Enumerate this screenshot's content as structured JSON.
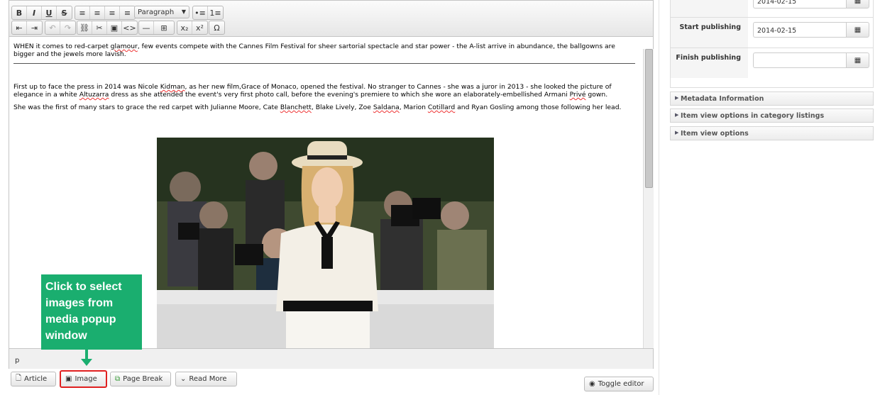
{
  "toolbar": {
    "row1": [
      "B",
      "I",
      "U",
      "S",
      "≡",
      "≡",
      "≡",
      "≡"
    ],
    "format_select": "Paragraph",
    "row2_extra": [
      "•≡",
      "1≡"
    ],
    "row3": [
      "⇤",
      "⇥",
      "↶",
      "↷",
      "⛓",
      "✂",
      "▣",
      "<>",
      "—",
      "⊞",
      "x₂",
      "x²",
      "Ω"
    ]
  },
  "content": {
    "p1a": "WHEN it comes to red-carpet ",
    "p1_glamour": "glamour",
    "p1b": ", few events compete with the Cannes Film Festival for sheer sartorial spectacle and star power - the A-list arrive in abundance, the ballgowns are bigger and the jewels more lavish.",
    "p2a": "First up to face the press in 2014 was Nicole ",
    "p2_kidman": "Kidman",
    "p2b": ", as her new film,Grace of Monaco, opened the festival. No stranger to Cannes - she was a juror in 2013 - she looked the picture of elegance in a white ",
    "p2_altuzarra": "Altuzarra",
    "p2c": " dress as she attended the event's very first photo call, before the evening's premiere to which she wore an elaborately-embellished Armani ",
    "p2_prive": "Privé",
    "p2d": " gown.",
    "p3a": "She was the first of many stars to grace the red carpet with Julianne Moore, Cate ",
    "p3_blanchett": "Blanchett",
    "p3b": ", Blake Lively, Zoe ",
    "p3_saldana": "Saldana",
    "p3c": ", Marion ",
    "p3_cotillard": "Cotillard",
    "p3d": " and Ryan Gosling among those following her lead."
  },
  "statusbar": {
    "path": "p"
  },
  "buttons": {
    "article": "Article",
    "image": "Image",
    "page_break": "Page Break",
    "read_more": "Read More",
    "toggle_editor": "Toggle editor"
  },
  "callout": {
    "text": "Click to select images from media popup window"
  },
  "publishing": {
    "row0_value": "2014-02-15",
    "start_label": "Start publishing",
    "start_value": "2014-02-15",
    "finish_label": "Finish publishing",
    "finish_value": ""
  },
  "accordion": [
    "Metadata Information",
    "Item view options in category listings",
    "Item view options"
  ],
  "colors": {
    "callout": "#1aae6f",
    "image_button_border": "#e02020"
  }
}
